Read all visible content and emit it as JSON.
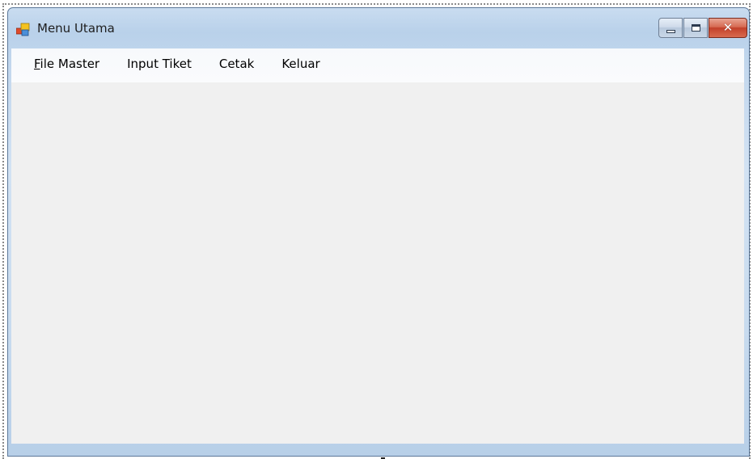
{
  "window": {
    "title": "Menu Utama",
    "icon": "app-form-icon",
    "caption_buttons": {
      "minimize": "minimize-icon",
      "maximize": "maximize-icon",
      "close": "close-icon"
    }
  },
  "menubar": {
    "file_master": {
      "mnemonic": "F",
      "rest": "ile Master"
    },
    "input_tiket": "Input Tiket",
    "cetak": "Cetak",
    "keluar": "Keluar"
  },
  "colors": {
    "client_background": "#f0f0f0",
    "menubar_background": "#f8fafc",
    "close_button": "#c9462f"
  }
}
